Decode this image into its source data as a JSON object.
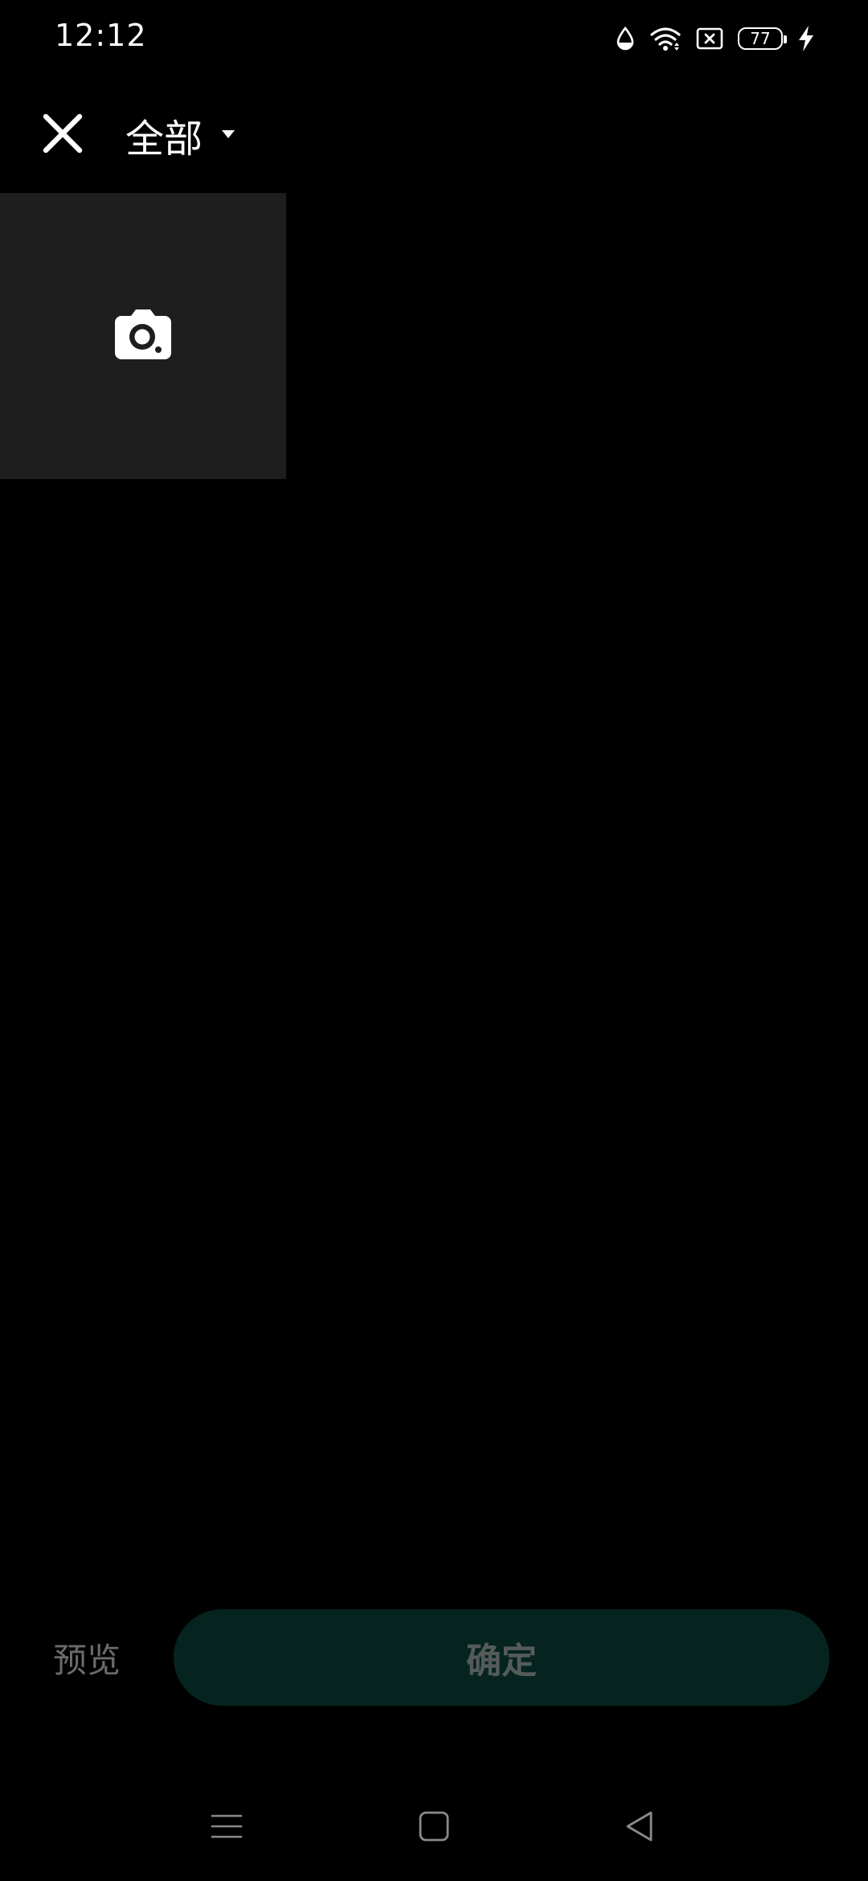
{
  "status_bar": {
    "time": "12:12",
    "battery_level": "77",
    "icons": [
      "data-saver-drop-icon",
      "wifi-icon",
      "sim-off-icon",
      "battery-icon",
      "charging-bolt-icon"
    ]
  },
  "app_bar": {
    "close_icon": "close-icon",
    "album_title": "全部",
    "dropdown_icon": "caret-down-icon"
  },
  "grid": {
    "camera_tile_icon": "camera-icon"
  },
  "bottom_bar": {
    "preview_label": "预览",
    "confirm_label": "确定"
  },
  "nav_bar": {
    "items": [
      "menu-icon",
      "home-square-icon",
      "back-triangle-icon"
    ]
  },
  "colors": {
    "background": "#000000",
    "tile_background": "#1e1e1e",
    "confirm_button_background": "#052420",
    "confirm_text_disabled": "#555b59",
    "preview_text_disabled": "#6b6b6b"
  }
}
